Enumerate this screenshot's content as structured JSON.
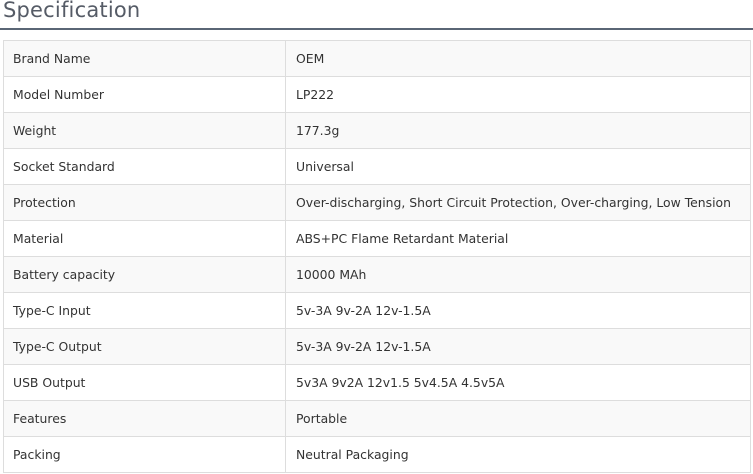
{
  "title": "Specification",
  "rows": [
    {
      "label": "Brand Name",
      "value": "OEM"
    },
    {
      "label": "Model Number",
      "value": "LP222"
    },
    {
      "label": "Weight",
      "value": "177.3g"
    },
    {
      "label": "Socket Standard",
      "value": "Universal"
    },
    {
      "label": "Protection",
      "value": "Over-discharging, Short Circuit Protection, Over-charging, Low Tension"
    },
    {
      "label": "Material",
      "value": "ABS+PC Flame Retardant Material"
    },
    {
      "label": "Battery capacity",
      "value": "10000 MAh"
    },
    {
      "label": "Type-C Input",
      "value": "5v-3A 9v-2A 12v-1.5A"
    },
    {
      "label": "Type-C Output",
      "value": "5v-3A 9v-2A 12v-1.5A"
    },
    {
      "label": "USB Output",
      "value": "5v3A 9v2A 12v1.5 5v4.5A 4.5v5A"
    },
    {
      "label": "Features",
      "value": "Portable"
    },
    {
      "label": "Packing",
      "value": "Neutral Packaging"
    }
  ]
}
